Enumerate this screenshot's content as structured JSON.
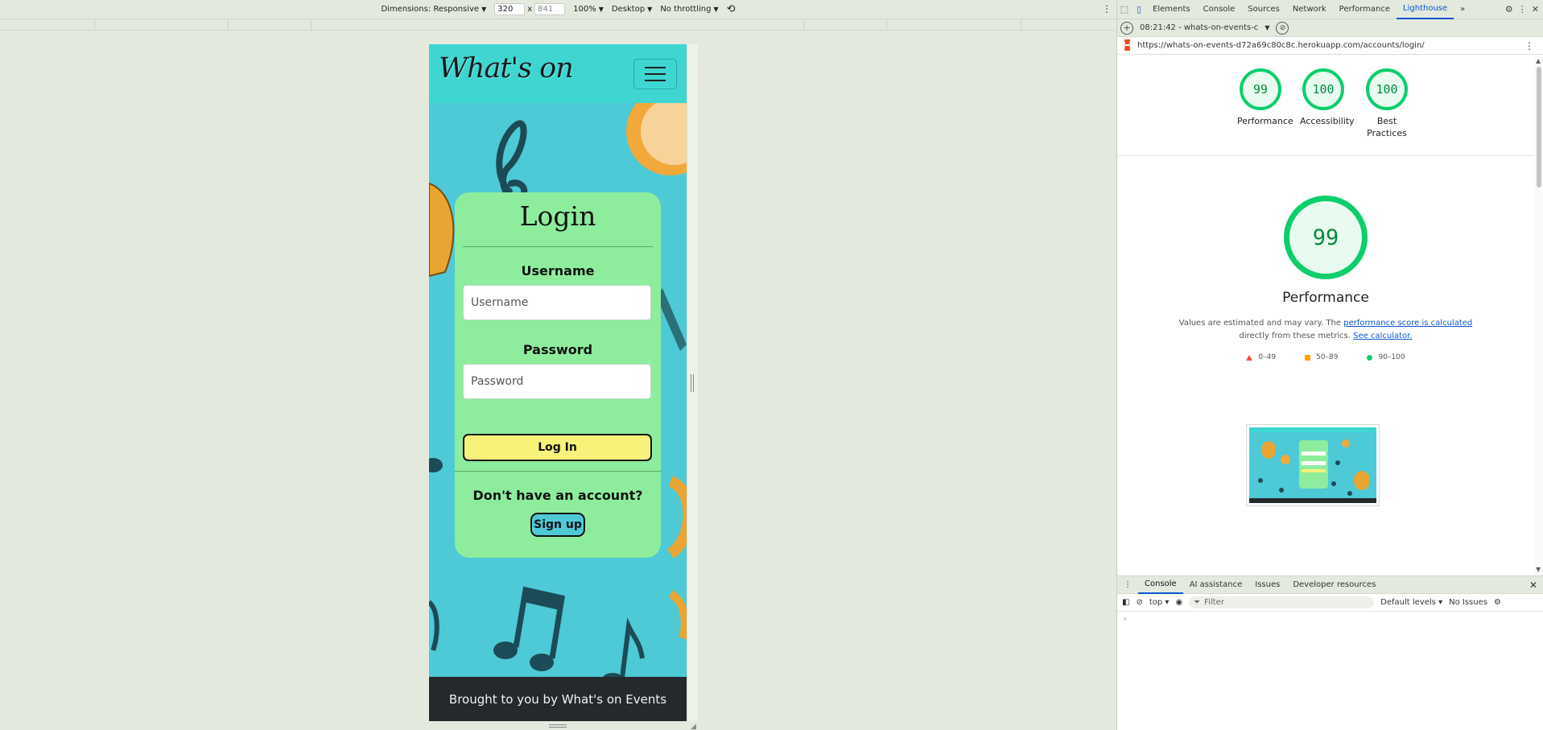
{
  "device_toolbar": {
    "dimensions_label": "Dimensions: Responsive",
    "width_value": "320",
    "times": "x",
    "height_value": "841",
    "zoom": "100%",
    "device_type": "Desktop",
    "throttling": "No throttling"
  },
  "site": {
    "logo": "What's on",
    "login": {
      "title": "Login",
      "username_label": "Username",
      "username_placeholder": "Username",
      "password_label": "Password",
      "password_placeholder": "Password",
      "login_button": "Log In",
      "no_account_text": "Don't have an account?",
      "signup_button": "Sign up"
    },
    "footer_text": "Brought to you by What's on Events"
  },
  "devtools": {
    "tabs": [
      "Elements",
      "Console",
      "Sources",
      "Network",
      "Performance",
      "Lighthouse"
    ],
    "active_tab": "Lighthouse",
    "report_selector": "08:21:42 - whats-on-events-c",
    "url": "https://whats-on-events-d72a69c80c8c.herokuapp.com/accounts/login/",
    "scores": [
      {
        "value": "99",
        "label": "Performance"
      },
      {
        "value": "100",
        "label": "Accessibility"
      },
      {
        "value": "100",
        "label": "Best Practices"
      }
    ],
    "main_score": "99",
    "main_title": "Performance",
    "note_prefix": "Values are estimated and may vary. The ",
    "note_link1": "performance score is calculated",
    "note_middle": "directly from these metrics. ",
    "note_link2": "See calculator.",
    "legend": [
      "0–49",
      "50–89",
      "90–100"
    ],
    "drawer_tabs": [
      "Console",
      "AI assistance",
      "Issues",
      "Developer resources"
    ],
    "console_context": "top",
    "filter_placeholder": "Filter",
    "levels": "Default levels",
    "issues": "No Issues",
    "prompt": "›"
  },
  "colors": {
    "page_bg": "#4ec9d6",
    "header_bg": "#3fd6d2",
    "card_bg": "#8ded9d",
    "login_button_bg": "#f6f27a",
    "footer_bg": "#25292c",
    "score_green": "#0cce6b",
    "link_blue": "#0b57d0"
  }
}
